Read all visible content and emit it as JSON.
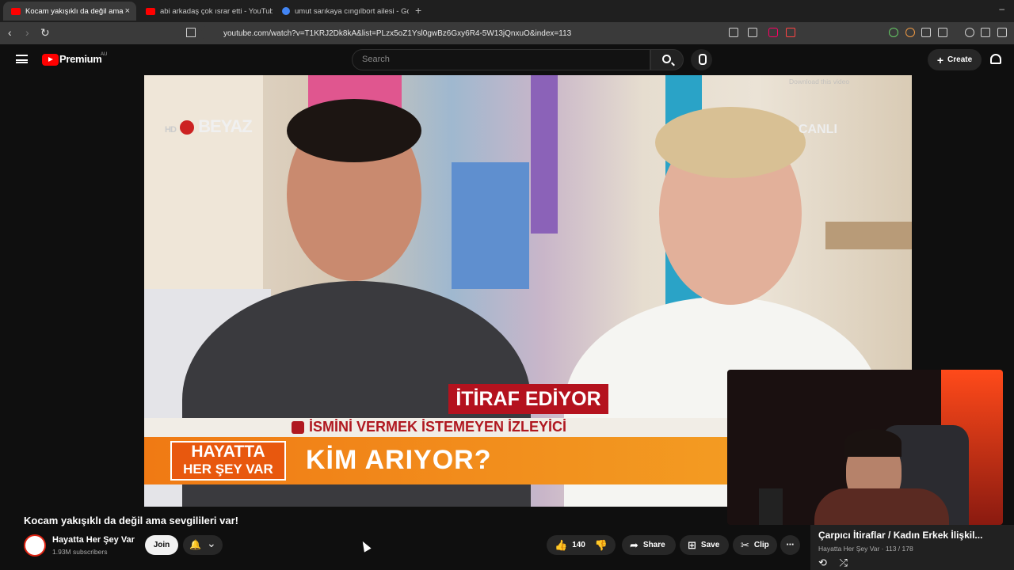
{
  "browser": {
    "tabs": [
      {
        "label": "Kocam yakışıklı da değil ama",
        "active": true
      },
      {
        "label": "abi arkadaş çok ısrar etti - YouTube",
        "active": false
      },
      {
        "label": "umut sarıkaya cıngılbort ailesi - Goog",
        "active": false
      }
    ],
    "tab_close": "×",
    "new_tab": "+",
    "minimize": "–",
    "url": "youtube.com/watch?v=T1KRJ2Dk8kA&list=PLzx5oZ1Ysl0gwBz6Gxy6R4-5W13jQnxuO&index=113"
  },
  "youtube": {
    "brand": "Premium",
    "region": "AU",
    "search_placeholder": "Search",
    "create_label": "Create"
  },
  "video": {
    "overlay_logo": "BEYAZ",
    "overlay_logo_prefix": "HD",
    "live_label": "CANLI",
    "download_label": "Download this video",
    "banner_tag": "İTİRAF EDİYOR",
    "caller_line": "İSMİNİ VERMEK İSTEMEYEN İZLEYİCİ",
    "show_name_1": "HAYATTA",
    "show_name_2": "HER ŞEY VAR",
    "caller_question": "KİM ARIYOR?",
    "title": "Kocam yakışıklı da değil ama sevgilileri var!"
  },
  "channel": {
    "name": "Hayatta Her Şey Var",
    "subscribers": "1.93M subscribers",
    "join_label": "Join"
  },
  "actions": {
    "likes": "140",
    "share": "Share",
    "save": "Save",
    "clip": "Clip",
    "more": "⋯"
  },
  "playlist": {
    "title": "Çarpıcı İtiraflar / Kadın Erkek İlişkil...",
    "meta": "Hayatta Her Şey Var · 113 / 178"
  },
  "icons": {
    "back": "‹",
    "forward": "›",
    "reload": "↻",
    "like": "👍",
    "dislike": "👎",
    "share": "➦",
    "save": "⊞",
    "clip": "✂",
    "bell": "🔔",
    "chevron": "⌄",
    "loop": "⟲",
    "shuffle": "⤮"
  },
  "colors": {
    "accent_red": "#ff0000",
    "banner_red": "#b4121e",
    "banner_orange": "#f07a14"
  }
}
